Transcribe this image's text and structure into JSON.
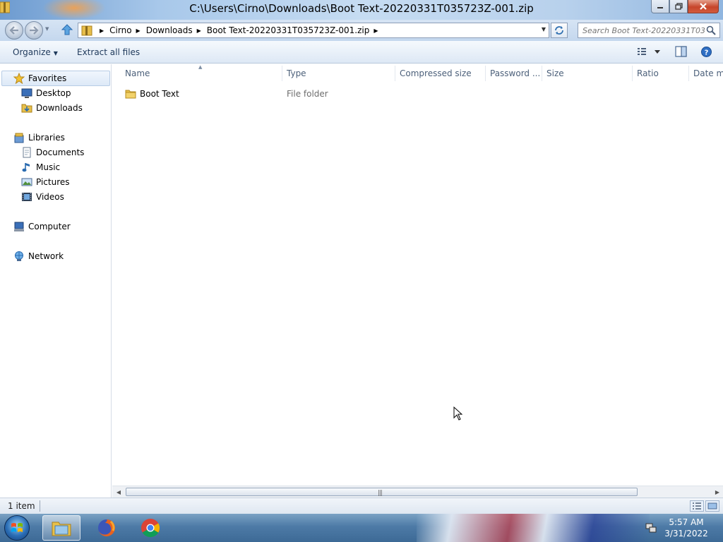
{
  "window": {
    "title": "C:\\Users\\Cirno\\Downloads\\Boot Text-20220331T035723Z-001.zip"
  },
  "address": {
    "breadcrumbs": [
      "Cirno",
      "Downloads",
      "Boot Text-20220331T035723Z-001.zip"
    ]
  },
  "search": {
    "placeholder": "Search Boot Text-20220331T035..."
  },
  "toolbar": {
    "organize_label": "Organize",
    "extract_label": "Extract all files"
  },
  "nav": {
    "favorites": "Favorites",
    "desktop": "Desktop",
    "downloads": "Downloads",
    "libraries": "Libraries",
    "documents": "Documents",
    "music": "Music",
    "pictures": "Pictures",
    "videos": "Videos",
    "computer": "Computer",
    "network": "Network"
  },
  "columns": {
    "name": "Name",
    "type": "Type",
    "compressed_size": "Compressed size",
    "password": "Password ...",
    "size": "Size",
    "ratio": "Ratio",
    "date": "Date mo"
  },
  "files": [
    {
      "name": "Boot Text",
      "type": "File folder"
    }
  ],
  "status": {
    "item_count": "1 item"
  },
  "clock": {
    "time": "5:57 AM",
    "date": "3/31/2022"
  },
  "colors": {
    "folder": "#e8c04a",
    "link_text": "#1e395b",
    "close_button": "#c7452a"
  }
}
